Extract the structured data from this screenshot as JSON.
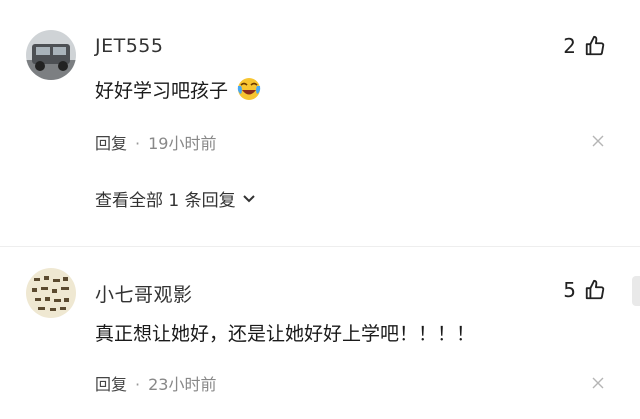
{
  "comments": [
    {
      "username": "JET555",
      "text": "好好学习吧孩子",
      "emoji": "crying-laughing-emoji",
      "likes": "2",
      "reply_label": "回复",
      "dot": "·",
      "time": "19小时前",
      "view_replies": "查看全部 1 条回复"
    },
    {
      "username": "小七哥观影",
      "text": "真正想让她好，还是让她好好上学吧！！！！",
      "likes": "5",
      "reply_label": "回复",
      "dot": "·",
      "time": "23小时前"
    }
  ],
  "icons": {
    "like": "thumbs-up-icon",
    "close": "close-icon",
    "expand": "chevron-down-icon"
  }
}
